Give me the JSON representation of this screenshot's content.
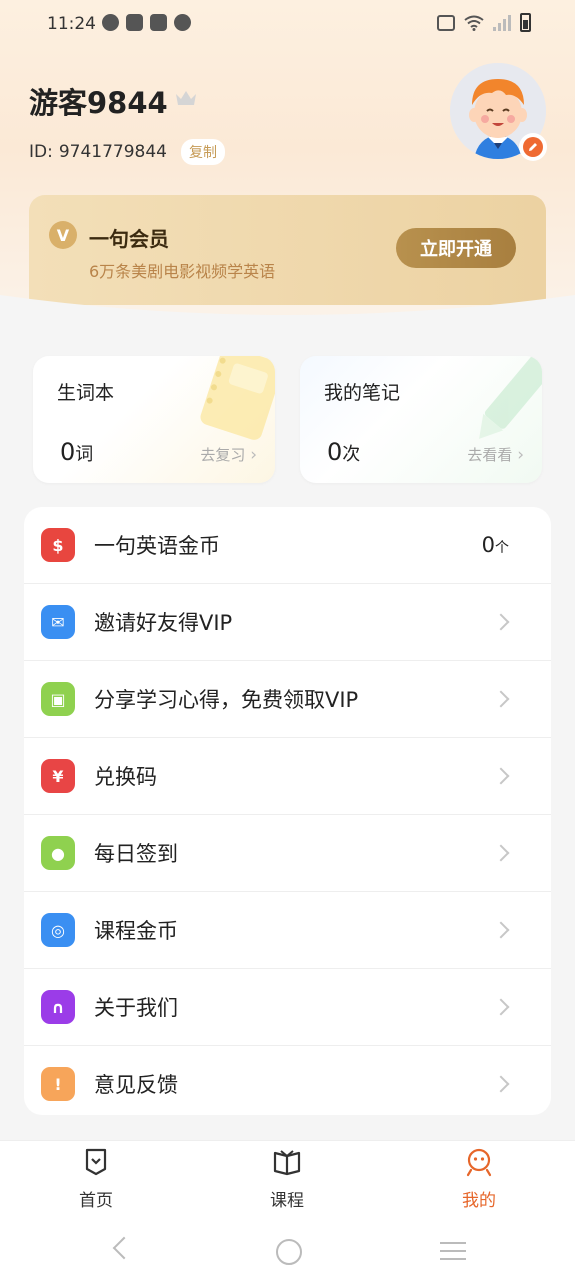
{
  "status_bar": {
    "time": "11:24"
  },
  "profile": {
    "username": "游客9844",
    "id_label": "ID:",
    "id_value": "9741779844",
    "copy_label": "复制"
  },
  "vip": {
    "badge": "V",
    "title": "一句会员",
    "subtitle": "6万条美剧电影视频学英语",
    "button": "立即开通"
  },
  "stats": [
    {
      "title": "生词本",
      "count": "0",
      "unit": "词",
      "link": "去复习"
    },
    {
      "title": "我的笔记",
      "count": "0",
      "unit": "次",
      "link": "去看看"
    }
  ],
  "menu": [
    {
      "label": "一句英语金币",
      "value": "0",
      "unit": "个",
      "icon": "coin-icon",
      "color": "#e8463f",
      "glyph": "$"
    },
    {
      "label": "邀请好友得VIP",
      "icon": "invite-mail-icon",
      "color": "#3a8ff2",
      "glyph": "✉"
    },
    {
      "label": "分享学习心得，免费领取VIP",
      "icon": "gift-icon",
      "color": "#8fd14f",
      "glyph": "▣"
    },
    {
      "label": "兑换码",
      "icon": "redeem-ticket-icon",
      "color": "#e84545",
      "glyph": "¥"
    },
    {
      "label": "每日签到",
      "icon": "location-pin-icon",
      "color": "#8fd14f",
      "glyph": "●"
    },
    {
      "label": "课程金币",
      "icon": "course-coins-icon",
      "color": "#3a8ff2",
      "glyph": "◎"
    },
    {
      "label": "关于我们",
      "icon": "headset-icon",
      "color": "#9b3ce8",
      "glyph": "∩"
    },
    {
      "label": "意见反馈",
      "icon": "feedback-icon",
      "color": "#f7a55a",
      "glyph": "!"
    }
  ],
  "tabs": [
    {
      "label": "首页",
      "active": false
    },
    {
      "label": "课程",
      "active": false
    },
    {
      "label": "我的",
      "active": true
    }
  ],
  "colors": {
    "accent": "#e6662a",
    "vip_gold": "#b8914e",
    "header_bg": "#fdf0e0"
  }
}
